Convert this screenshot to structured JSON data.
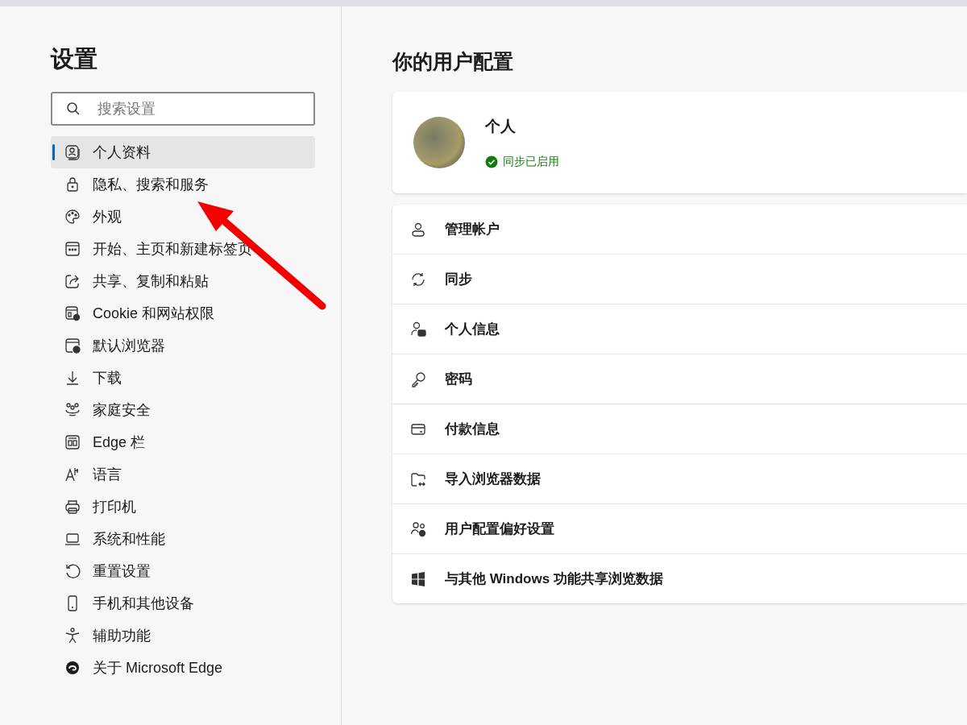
{
  "sidebar": {
    "title": "设置",
    "search": {
      "placeholder": "搜索设置"
    },
    "items": [
      {
        "label": "个人资料",
        "selected": true
      },
      {
        "label": "隐私、搜索和服务",
        "selected": false
      },
      {
        "label": "外观",
        "selected": false
      },
      {
        "label": "开始、主页和新建标签页",
        "selected": false
      },
      {
        "label": "共享、复制和粘贴",
        "selected": false
      },
      {
        "label": "Cookie 和网站权限",
        "selected": false
      },
      {
        "label": "默认浏览器",
        "selected": false
      },
      {
        "label": "下载",
        "selected": false
      },
      {
        "label": "家庭安全",
        "selected": false
      },
      {
        "label": "Edge 栏",
        "selected": false
      },
      {
        "label": "语言",
        "selected": false
      },
      {
        "label": "打印机",
        "selected": false
      },
      {
        "label": "系统和性能",
        "selected": false
      },
      {
        "label": "重置设置",
        "selected": false
      },
      {
        "label": "手机和其他设备",
        "selected": false
      },
      {
        "label": "辅助功能",
        "selected": false
      },
      {
        "label": "关于 Microsoft Edge",
        "selected": false
      }
    ]
  },
  "main": {
    "title": "你的用户配置",
    "profile": {
      "name": "个人",
      "sync_status": "同步已启用"
    },
    "options": [
      {
        "label": "管理帐户"
      },
      {
        "label": "同步"
      },
      {
        "label": "个人信息"
      },
      {
        "label": "密码"
      },
      {
        "label": "付款信息"
      },
      {
        "label": "导入浏览器数据"
      },
      {
        "label": "用户配置偏好设置"
      },
      {
        "label": "与其他 Windows 功能共享浏览数据"
      }
    ]
  }
}
